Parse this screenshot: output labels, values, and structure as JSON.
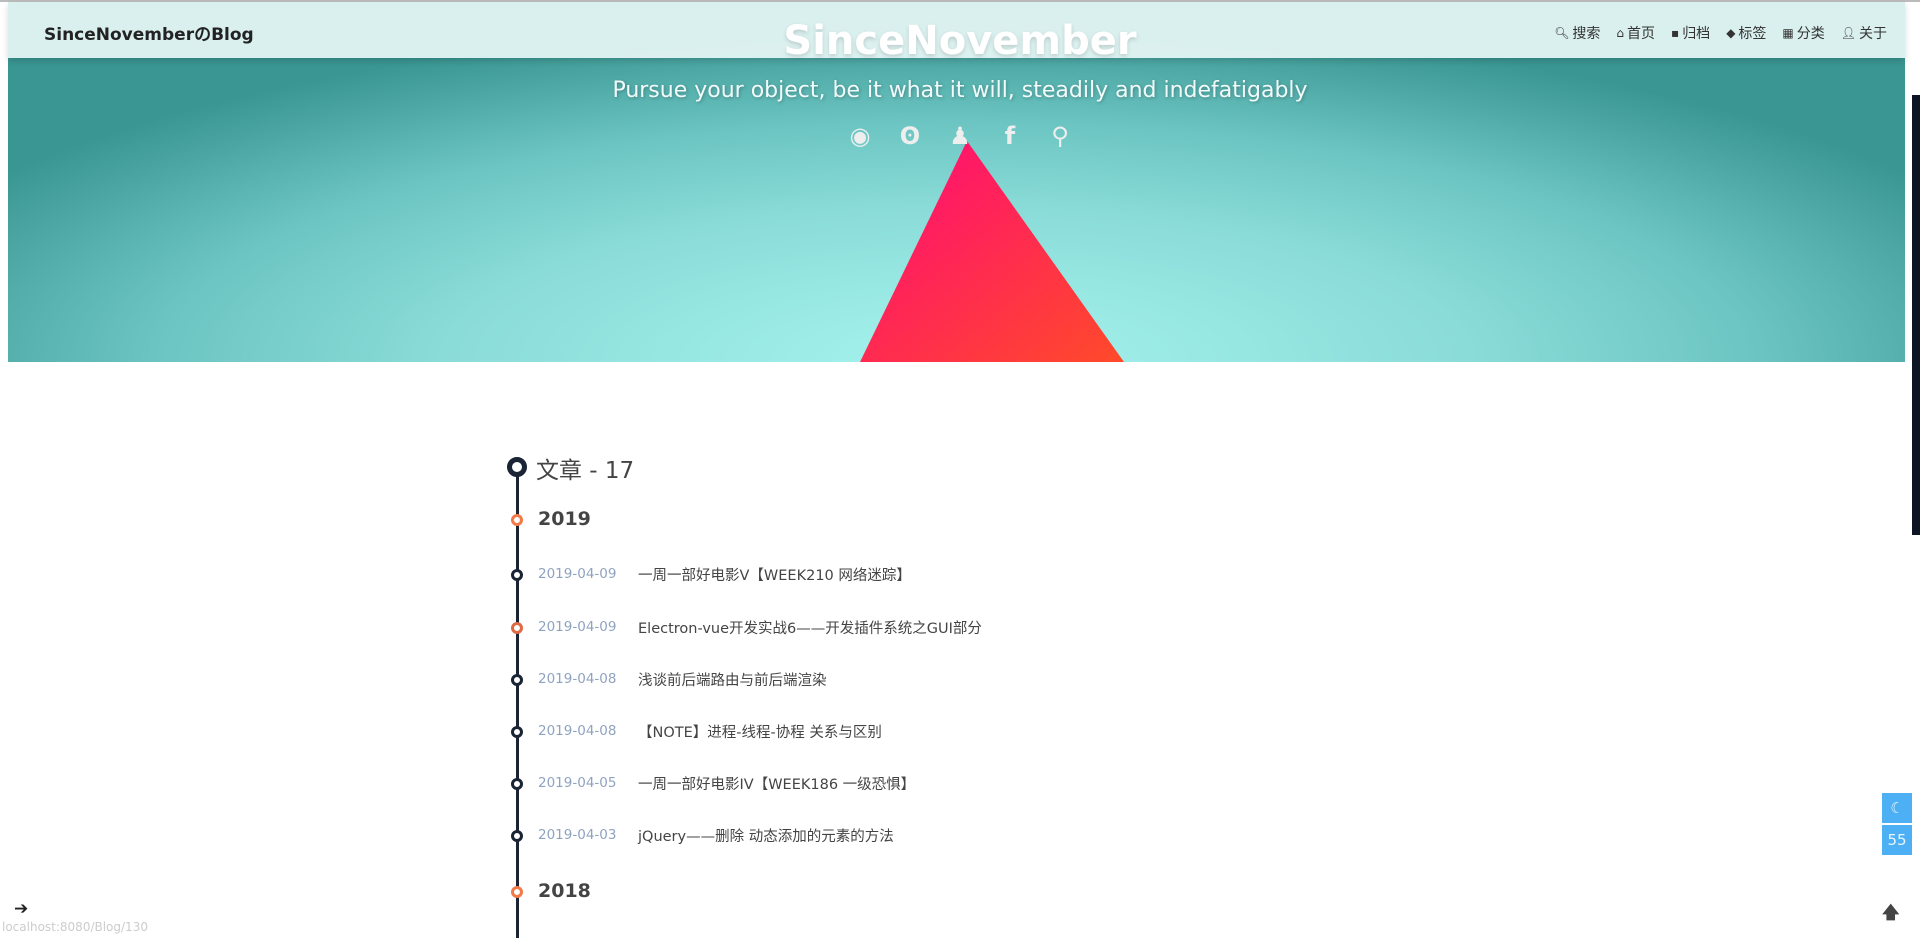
{
  "header": {
    "brand": "SinceNovemberのBlog",
    "nav": [
      {
        "icon": "search-icon",
        "glyph": "🔍︎",
        "label": "搜索"
      },
      {
        "icon": "home-icon",
        "glyph": "⌂",
        "label": "首页"
      },
      {
        "icon": "archive-icon",
        "glyph": "▪",
        "label": "归档"
      },
      {
        "icon": "tags-icon",
        "glyph": "◆",
        "label": "标签"
      },
      {
        "icon": "grid-icon",
        "glyph": "▦",
        "label": "分类"
      },
      {
        "icon": "user-icon",
        "glyph": "👤︎",
        "label": "关于"
      }
    ]
  },
  "hero": {
    "title": "SinceNovember",
    "subtitle": "Pursue your object, be it what it will, steadily and indefatigably",
    "social": [
      {
        "icon": "github-icon",
        "glyph": "◉"
      },
      {
        "icon": "weibo-icon",
        "glyph": "ʘ"
      },
      {
        "icon": "qq-icon",
        "glyph": "♟"
      },
      {
        "icon": "facebook-icon",
        "glyph": "f"
      },
      {
        "icon": "search-icon",
        "glyph": "⚲"
      }
    ],
    "colors": {
      "teal": "#3a9692",
      "triangle_top": "#ff0a78",
      "triangle_bottom": "#ff4a2a"
    }
  },
  "timeline": {
    "count_label": "文章 - 17",
    "years": [
      "2019",
      "2018"
    ],
    "posts": [
      {
        "date": "2019-04-09",
        "title": "一周一部好电影V【WEEK210 网络迷踪】"
      },
      {
        "date": "2019-04-09",
        "title": "Electron-vue开发实战6——开发插件系统之GUI部分"
      },
      {
        "date": "2019-04-08",
        "title": "浅谈前后端路由与前后端渲染"
      },
      {
        "date": "2019-04-08",
        "title": "【NOTE】进程-线程-协程 关系与区别"
      },
      {
        "date": "2019-04-05",
        "title": "一周一部好电影IV【WEEK186 一级恐惧】"
      },
      {
        "date": "2019-04-03",
        "title": "jQuery——删除 动态添加的元素的方法"
      }
    ]
  },
  "float": {
    "dark_mode_glyph": "☾",
    "counter": "55",
    "up_glyph": "🡅",
    "toggle_glyph": "➔"
  },
  "status_url": "localhost:8080/Blog/130"
}
